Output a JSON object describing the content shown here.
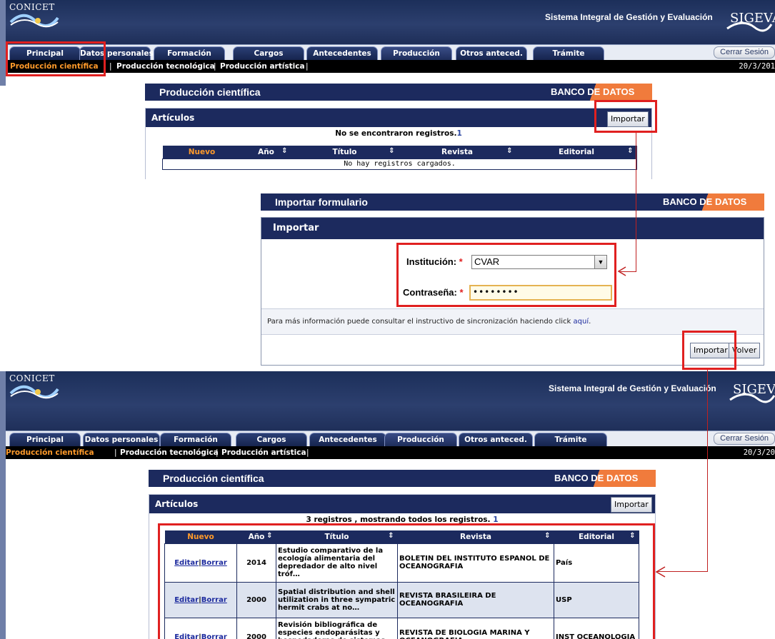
{
  "header": {
    "logo_text": "CONICET",
    "system_title": "Sistema Integral de Gestión y Evaluación",
    "sig_logo_text": "SIGEVA",
    "tabs": [
      "Principal",
      "Datos personales",
      "Formación",
      "Cargos",
      "Antecedentes",
      "Producción",
      "Otros anteced.",
      "Trámite"
    ],
    "logout_label": "Cerrar Sesión",
    "subnav": [
      "Producción científica",
      "Producción tecnológica",
      "Producción artística"
    ],
    "date_top": "20/3/201",
    "date_bottom": "20/3/20"
  },
  "section": {
    "title": "Producción científica",
    "bank_label_1": "BANCO ",
    "bank_label_2": "DE DATOS",
    "panel_title": "Artículos",
    "import_label": "Importar"
  },
  "before": {
    "message": "No se encontraron registros.",
    "message_count": "1",
    "empty_row": "No hay registros cargados."
  },
  "columns": [
    "Nuevo",
    "Año",
    "Título",
    "Revista",
    "Editorial"
  ],
  "import_form": {
    "title": "Importar formulario",
    "panel_title": "Importar",
    "institution_label": "Institución:",
    "institution_value": "CVAR",
    "password_label": "Contraseña:",
    "password_mask": "••••••••",
    "info_text": "Para más información puede consultar el instructivo de sincronización haciendo click ",
    "info_link": "aquí",
    "info_end": ".",
    "import_label": "Importar",
    "back_label": "Volver"
  },
  "after": {
    "message": "3 registros , mostrando todos los registros.",
    "message_count": "1",
    "edit_label": "Editar",
    "delete_label": "Borrar",
    "rows": [
      {
        "year": "2014",
        "title": "Estudio comparativo de la ecología alimentaria del depredador de alto nivel tróf…",
        "journal": "BOLETIN DEL INSTITUTO ESPANOL DE OCEANOGRAFIA",
        "publisher": "País"
      },
      {
        "year": "2000",
        "title": "Spatial distribution and shell utilization in three sympatric hermit crabs at no…",
        "journal": "REVISTA BRASILEIRA DE OCEANOGRAFIA",
        "publisher": "USP"
      },
      {
        "year": "2000",
        "title": "Revisión bibliográfica de especies endoparásitas y hospedadoras de sistemas acuá…",
        "journal": "REVISTA DE BIOLOGIA MARINA Y OCEANOGRAFIA",
        "publisher": "INST OCEANOLOGIA"
      }
    ]
  }
}
